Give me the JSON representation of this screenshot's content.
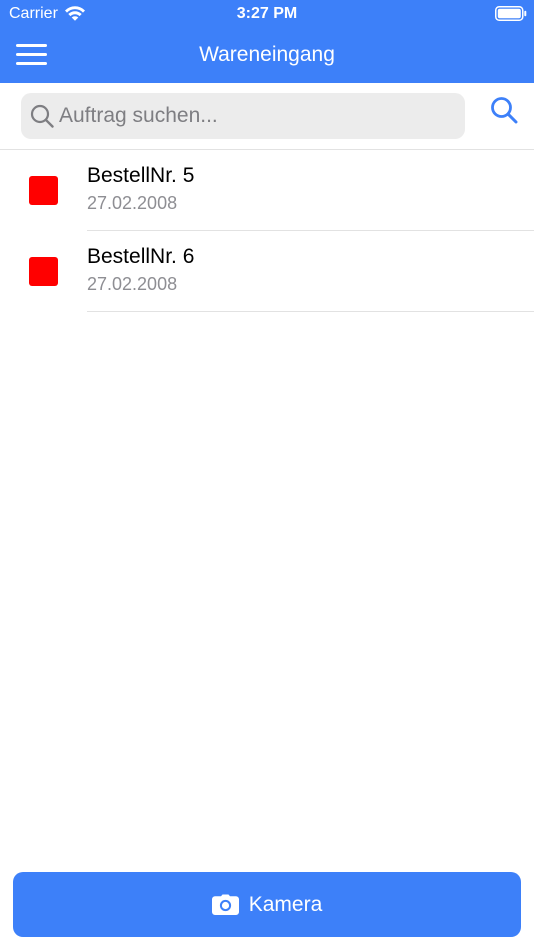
{
  "theme": {
    "accent": "#3d80f9",
    "status_red": "#ff0000"
  },
  "status_bar": {
    "carrier": "Carrier",
    "time": "3:27 PM",
    "icons": [
      "wifi-icon",
      "battery-icon"
    ]
  },
  "nav": {
    "title": "Wareneingang",
    "menu_icon": "menu-icon"
  },
  "search": {
    "placeholder": "Auftrag suchen...",
    "value": "",
    "icon": "search-icon"
  },
  "orders": [
    {
      "title": "BestellNr. 5",
      "date": "27.02.2008",
      "status": "red"
    },
    {
      "title": "BestellNr. 6",
      "date": "27.02.2008",
      "status": "red"
    }
  ],
  "camera_button": {
    "label": "Kamera",
    "icon": "camera-icon"
  }
}
